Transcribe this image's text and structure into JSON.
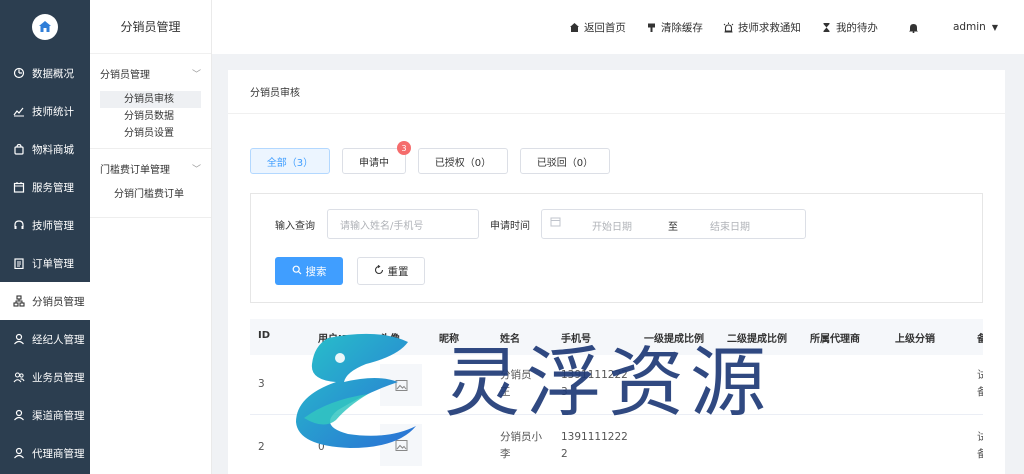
{
  "sidebar": {
    "items": [
      {
        "label": "数据概况",
        "icon": "dashboard-icon"
      },
      {
        "label": "技师统计",
        "icon": "chart-icon"
      },
      {
        "label": "物料商城",
        "icon": "bag-icon"
      },
      {
        "label": "服务管理",
        "icon": "calendar-icon"
      },
      {
        "label": "技师管理",
        "icon": "headset-icon"
      },
      {
        "label": "订单管理",
        "icon": "clipboard-icon"
      },
      {
        "label": "分销员管理",
        "icon": "org-icon"
      },
      {
        "label": "经纪人管理",
        "icon": "person-icon"
      },
      {
        "label": "业务员管理",
        "icon": "people-icon"
      },
      {
        "label": "渠道商管理",
        "icon": "person-icon"
      },
      {
        "label": "代理商管理",
        "icon": "person-icon"
      }
    ]
  },
  "submenu": {
    "title": "分销员管理",
    "group1": {
      "label": "分销员管理",
      "items": [
        "分销员审核",
        "分销员数据",
        "分销员设置"
      ]
    },
    "group2": {
      "label": "门槛费订单管理",
      "items": [
        "分销门槛费订单"
      ]
    }
  },
  "topbar": {
    "home": "返回首页",
    "clear_cache": "清除缓存",
    "help_notice": "技师求救通知",
    "todo": "我的待办",
    "user": "admin"
  },
  "page": {
    "breadcrumb": "分销员审核"
  },
  "tabs": {
    "all": "全部（3）",
    "applying": "申请中",
    "applying_badge": "3",
    "authorized": "已授权（0）",
    "rejected": "已驳回（0）"
  },
  "filter": {
    "query_label": "输入查询",
    "query_placeholder": "请输入姓名/手机号",
    "time_label": "申请时间",
    "start_placeholder": "开始日期",
    "to": "至",
    "end_placeholder": "结束日期",
    "search_btn": "搜索",
    "reset_btn": "重置"
  },
  "table": {
    "headers": [
      "ID",
      "用户ID",
      "头像",
      "昵称",
      "姓名",
      "手机号",
      "一级提成比例",
      "二级提成比例",
      "所属代理商",
      "上级分销",
      "备"
    ],
    "rows": [
      {
        "id": "3",
        "user_id": "",
        "name_line1": "分销员",
        "name_line2": "王",
        "phone_line1": "1391111222",
        "phone_line2": "3",
        "extra": [
          "试",
          "备"
        ]
      },
      {
        "id": "2",
        "user_id": "0",
        "name_line1": "分销员小",
        "name_line2": "李",
        "phone_line1": "1391111222",
        "phone_line2": "2",
        "extra": [
          "试",
          "备"
        ]
      }
    ]
  },
  "watermark": {
    "text": "灵浮资源"
  }
}
